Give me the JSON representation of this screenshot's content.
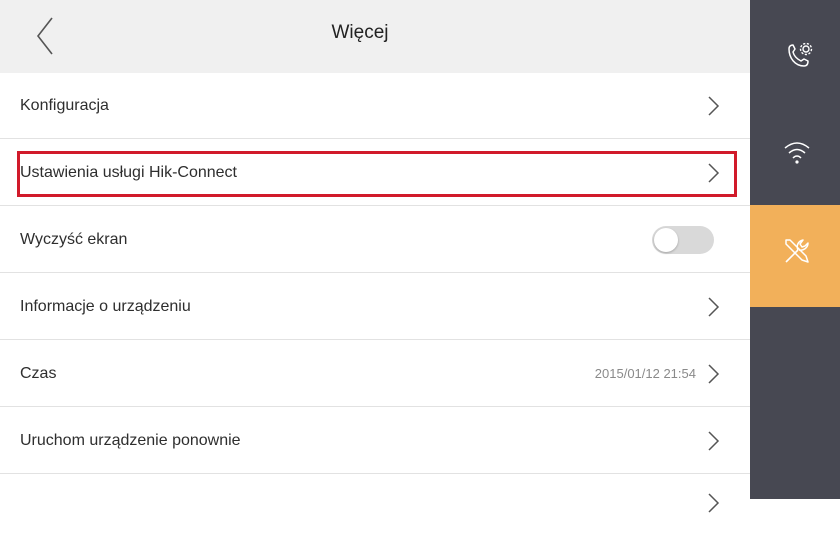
{
  "header": {
    "title": "Więcej",
    "back_icon": "chevron-left-icon"
  },
  "menu": {
    "items": [
      {
        "label": "Konfiguracja",
        "icon": "chevron-right-icon"
      },
      {
        "label": "Ustawienia usługi Hik-Connect",
        "icon": "chevron-right-icon",
        "highlighted": true
      },
      {
        "label": "Wyczyść ekran",
        "control": "toggle",
        "toggle_on": false
      },
      {
        "label": "Informacje o urządzeniu",
        "icon": "chevron-right-icon"
      },
      {
        "label": "Czas",
        "value": "2015/01/12  21:54",
        "icon": "chevron-right-icon"
      },
      {
        "label": "Uruchom urządzenie ponownie",
        "icon": "chevron-right-icon"
      }
    ]
  },
  "sidebar": {
    "items": [
      {
        "icon": "phone-settings-icon",
        "active": false
      },
      {
        "icon": "wifi-icon",
        "active": false
      },
      {
        "icon": "tools-icon",
        "active": true
      }
    ]
  },
  "colors": {
    "header_bg": "#f0f0f0",
    "sidebar_bg": "#474852",
    "sidebar_active": "#f2b05a",
    "highlight_border": "#d11a2a",
    "toggle_off": "#d9d9d9"
  }
}
